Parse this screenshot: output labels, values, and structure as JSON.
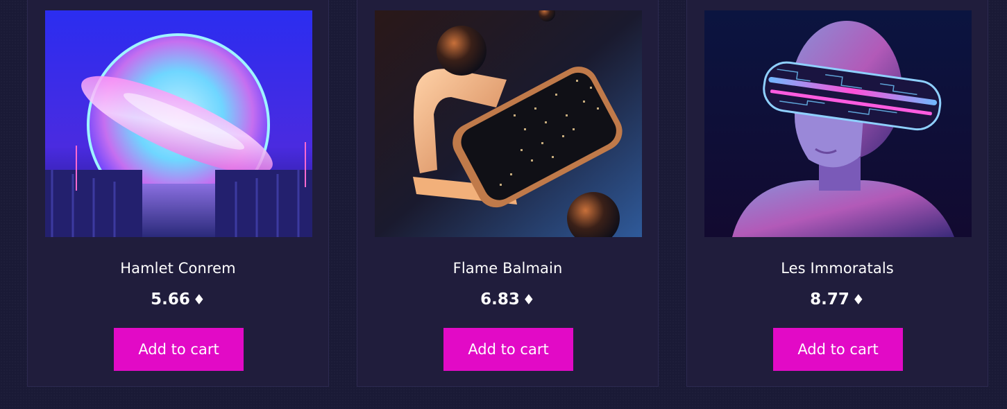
{
  "products": [
    {
      "name": "Hamlet Conrem",
      "price": "5.66",
      "currency_icon": "ethereum-diamond-icon",
      "button_label": "Add to cart",
      "image_name": "neon-portal-pier-image"
    },
    {
      "name": "Flame Balmain",
      "price": "6.83",
      "currency_icon": "ethereum-diamond-icon",
      "button_label": "Add to cart",
      "image_name": "vr-headset-spheres-image"
    },
    {
      "name": "Les Immoratals",
      "price": "8.77",
      "currency_icon": "ethereum-diamond-icon",
      "button_label": "Add to cart",
      "image_name": "neon-visor-bust-image"
    }
  ],
  "colors": {
    "background": "#1a1a36",
    "card": "#201d3c",
    "button": "#e20ac6",
    "text": "#ffffff"
  }
}
